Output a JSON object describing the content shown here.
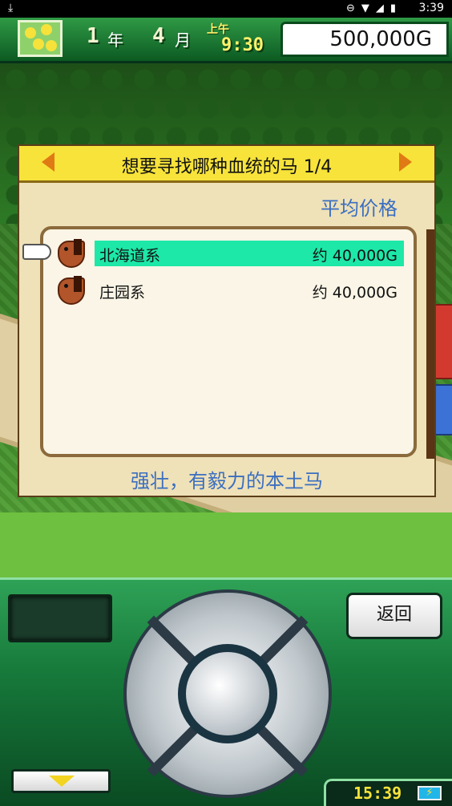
{
  "status_bar": {
    "time": "3:39"
  },
  "hud": {
    "year_num": "1",
    "year_unit": "年",
    "month_num": "4",
    "month_unit": "月",
    "ampm": "上午",
    "clock": "9:30",
    "money": "500,000G"
  },
  "dialog": {
    "title": "想要寻找哪种血统的马 1/4",
    "column_header": "平均价格",
    "items": [
      {
        "name": "北海道系",
        "price": "约 40,000G",
        "selected": true
      },
      {
        "name": "庄园系",
        "price": "约 40,000G",
        "selected": false
      }
    ],
    "description": "强壮，有毅力的本土马"
  },
  "panel": {
    "back_label": "返回",
    "clock": "15:39"
  },
  "colors": {
    "selection": "#1de8a8",
    "title_bar": "#f7e33a",
    "accent_text": "#3b6fc0",
    "panel_green": "#177a3b"
  }
}
